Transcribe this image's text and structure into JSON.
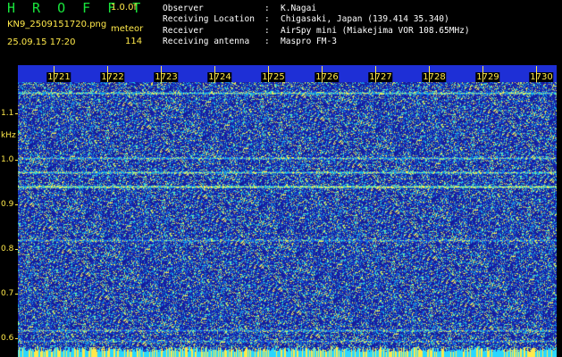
{
  "header": {
    "title": "H R O F F T",
    "version": "1.0.0f",
    "filename": "KN9_2509151720.png",
    "mode": "meteor",
    "datetime": "25.09.15 17:20",
    "count": "114",
    "info": [
      {
        "label": "Observer",
        "value": "K.Nagai"
      },
      {
        "label": "Receiving Location",
        "value": "Chigasaki, Japan (139.414 35.340)"
      },
      {
        "label": "Receiver",
        "value": "AirSpy mini (Miakejima VOR 108.65MHz)"
      },
      {
        "label": "Receiving antenna",
        "value": "Maspro FM-3"
      }
    ],
    "separator": ":"
  },
  "axis": {
    "unit": "kHz",
    "y_ticks": [
      "1.1",
      "1.0",
      "0.9",
      "0.8",
      "0.7",
      "0.6"
    ],
    "x_ticks": [
      "1721",
      "1722",
      "1723",
      "1724",
      "1725",
      "1726",
      "1727",
      "1728",
      "1729",
      "1730"
    ]
  },
  "colors": {
    "background": "#000000",
    "text_yellow": "#ffe94a",
    "title_green": "#19e43c",
    "spectrogram_base": "#1e2fd6",
    "bottom_band_cyan": "#2ad7ff"
  }
}
